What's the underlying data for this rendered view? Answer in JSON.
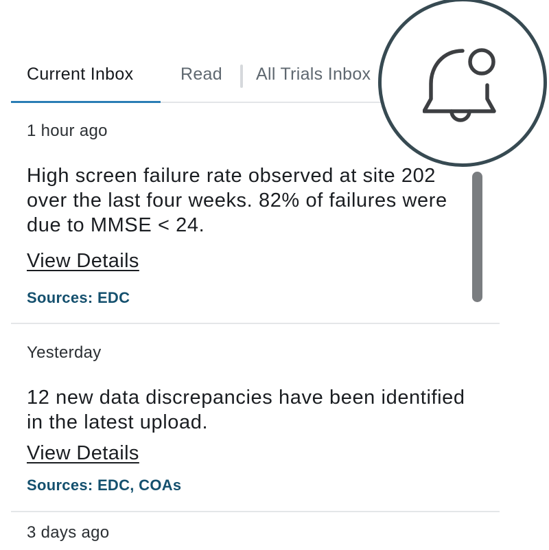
{
  "tabs": [
    {
      "label": "Current Inbox",
      "active": true
    },
    {
      "label": "Read",
      "active": false
    },
    {
      "label": "All Trials Inbox",
      "active": false
    }
  ],
  "notifications": [
    {
      "timestamp": "1 hour ago",
      "message": "High screen failure rate observed at site 202 over the last four weeks. 82% of failures were due to MMSE < 24.",
      "link": "View Details",
      "sources": "Sources: EDC"
    },
    {
      "timestamp": "Yesterday",
      "message": "12 new data discrepancies have been identified in the latest upload.",
      "link": "View Details",
      "sources": "Sources: EDC, COAs"
    },
    {
      "timestamp": "3 days ago"
    }
  ],
  "icons": {
    "bell": "bell-with-badge-icon"
  },
  "colors": {
    "accent": "#2a7db5",
    "sources_text": "#14506e",
    "magnifier_ring": "#374a52",
    "scrollbar": "#7a7d80"
  }
}
